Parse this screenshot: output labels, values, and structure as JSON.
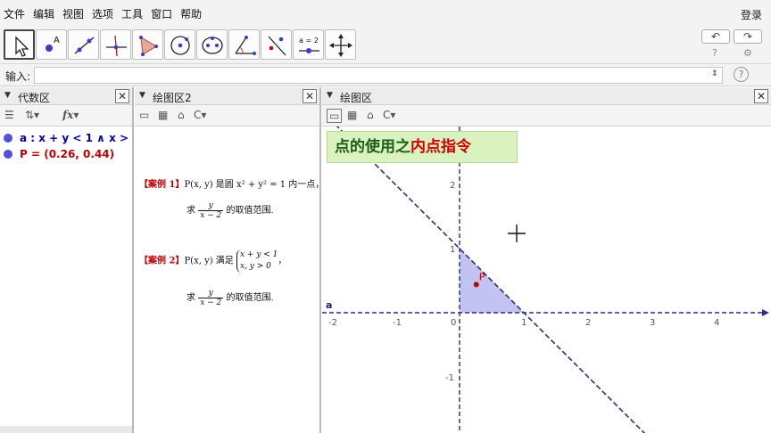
{
  "menu": {
    "items": [
      "文件",
      "编辑",
      "视图",
      "选项",
      "工具",
      "窗口",
      "帮助"
    ],
    "login": "登录"
  },
  "toolbar": {
    "tools": [
      "move-tool",
      "point-tool",
      "line-tool",
      "perpendicular-tool",
      "polygon-tool",
      "circle-tool",
      "conic-tool",
      "angle-tool",
      "reflect-tool",
      "slider-tool",
      "move-view-tool"
    ],
    "slider_label": "a = 2",
    "undo": "↶",
    "redo": "↷",
    "help": "?",
    "settings": "⚙"
  },
  "input_bar": {
    "label": "输入:",
    "value": "",
    "help": "?"
  },
  "algebra": {
    "title": "代数区",
    "items": [
      {
        "text": "a : x + y < 1 ∧ x >",
        "color": "#0000aa"
      },
      {
        "text": "P = (0.26, 0.44)",
        "color": "#c00000"
      }
    ]
  },
  "graphics2": {
    "title": "绘图区2",
    "case1": {
      "tag": "【案例 1】",
      "line1": "P(x, y) 是圆 x² + y² = 1 内一点，",
      "ask": "求",
      "frac_num": "y",
      "frac_den": "x − 2",
      "tail": "的取值范围."
    },
    "case2": {
      "tag": "【案例 2】",
      "line1_pre": "P(x, y) 满足",
      "sys_1": "x + y < 1",
      "sys_2": "x, y > 0",
      "line1_post": "，",
      "ask": "求",
      "frac_num": "y",
      "frac_den": "x − 2",
      "tail": "的取值范围."
    }
  },
  "graphics1": {
    "title": "绘图区",
    "banner_normal": "点的使用之",
    "banner_highlight": "内点指令",
    "line_label": "a",
    "point_label": "P"
  },
  "chart_data": {
    "type": "scatter",
    "xlim": [
      -2,
      4.5
    ],
    "ylim": [
      -1.8,
      2.4
    ],
    "x_ticks": [
      "-2",
      "-1",
      "0",
      "1",
      "2",
      "3",
      "4"
    ],
    "y_ticks": [
      "2",
      "1",
      "-1"
    ],
    "region_vertices": [
      [
        0,
        0
      ],
      [
        1,
        0
      ],
      [
        0,
        1
      ]
    ],
    "boundary_line": "x + y = 1",
    "point": {
      "name": "P",
      "x": 0.26,
      "y": 0.44
    },
    "colors": {
      "region": "#b8b8ef",
      "line": "#2c2c8c",
      "point": "#c00000"
    }
  }
}
